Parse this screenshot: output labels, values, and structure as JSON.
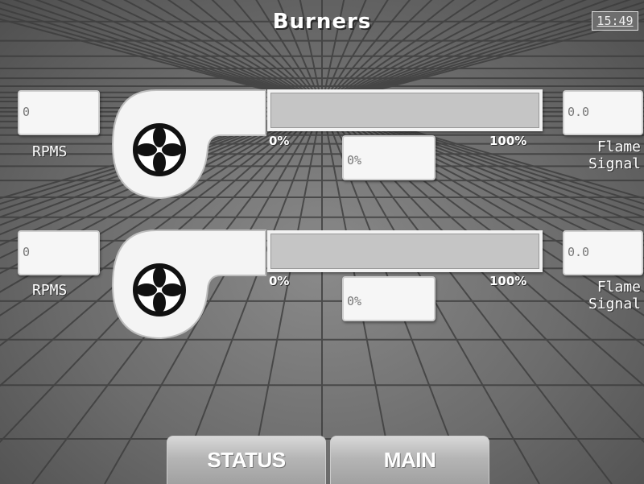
{
  "header": {
    "title": "Burners",
    "time": "15:49"
  },
  "burners": [
    {
      "rpm_value": "0",
      "rpm_label": "RPMS",
      "bar_level": 0,
      "bar_min_label": "0%",
      "bar_max_label": "100%",
      "percent_value": "0%",
      "flame_value": "0.0",
      "flame_label_line1": "Flame",
      "flame_label_line2": "Signal"
    },
    {
      "rpm_value": "0",
      "rpm_label": "RPMS",
      "bar_level": 0,
      "bar_min_label": "0%",
      "bar_max_label": "100%",
      "percent_value": "0%",
      "flame_value": "0.0",
      "flame_label_line1": "Flame",
      "flame_label_line2": "Signal"
    }
  ],
  "nav": {
    "status_label": "STATUS",
    "main_label": "MAIN"
  },
  "icons": {
    "blower": "fan-blower-icon"
  }
}
